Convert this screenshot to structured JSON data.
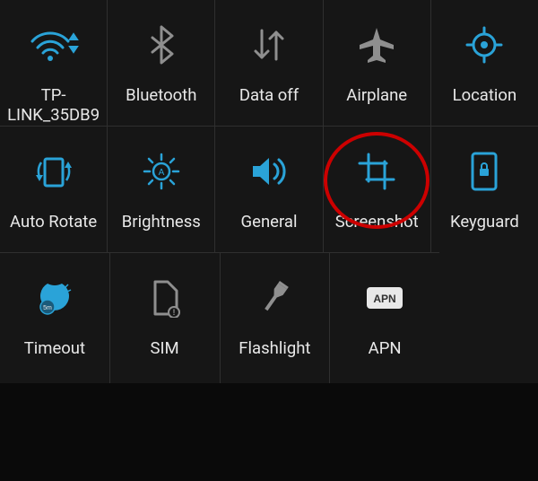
{
  "colors": {
    "accent": "#2aa3d8",
    "muted": "#8f8f8f",
    "text": "#e8e8e8",
    "highlight_ring": "#cc0000",
    "panel_bg": "#161616"
  },
  "tiles": {
    "wifi": {
      "label": "TP-LINK_35DB9",
      "icon": "wifi-icon"
    },
    "bluetooth": {
      "label": "Bluetooth",
      "icon": "bluetooth-icon"
    },
    "data": {
      "label": "Data off",
      "icon": "data-icon"
    },
    "airplane": {
      "label": "Airplane",
      "icon": "airplane-icon"
    },
    "location": {
      "label": "Location",
      "icon": "location-icon"
    },
    "autorotate": {
      "label": "Auto Rotate",
      "icon": "auto-rotate-icon"
    },
    "brightness": {
      "label": "Brightness",
      "icon": "brightness-icon"
    },
    "sound": {
      "label": "General",
      "icon": "volume-icon"
    },
    "screenshot": {
      "label": "Screenshot",
      "icon": "screenshot-icon",
      "highlighted": true
    },
    "keyguard": {
      "label": "Keyguard",
      "icon": "keyguard-icon"
    },
    "timeout": {
      "label": "Timeout",
      "icon": "timeout-icon"
    },
    "sim": {
      "label": "SIM",
      "icon": "sim-icon"
    },
    "flashlight": {
      "label": "Flashlight",
      "icon": "flashlight-icon"
    },
    "apn": {
      "label": "APN",
      "icon": "apn-icon"
    }
  }
}
